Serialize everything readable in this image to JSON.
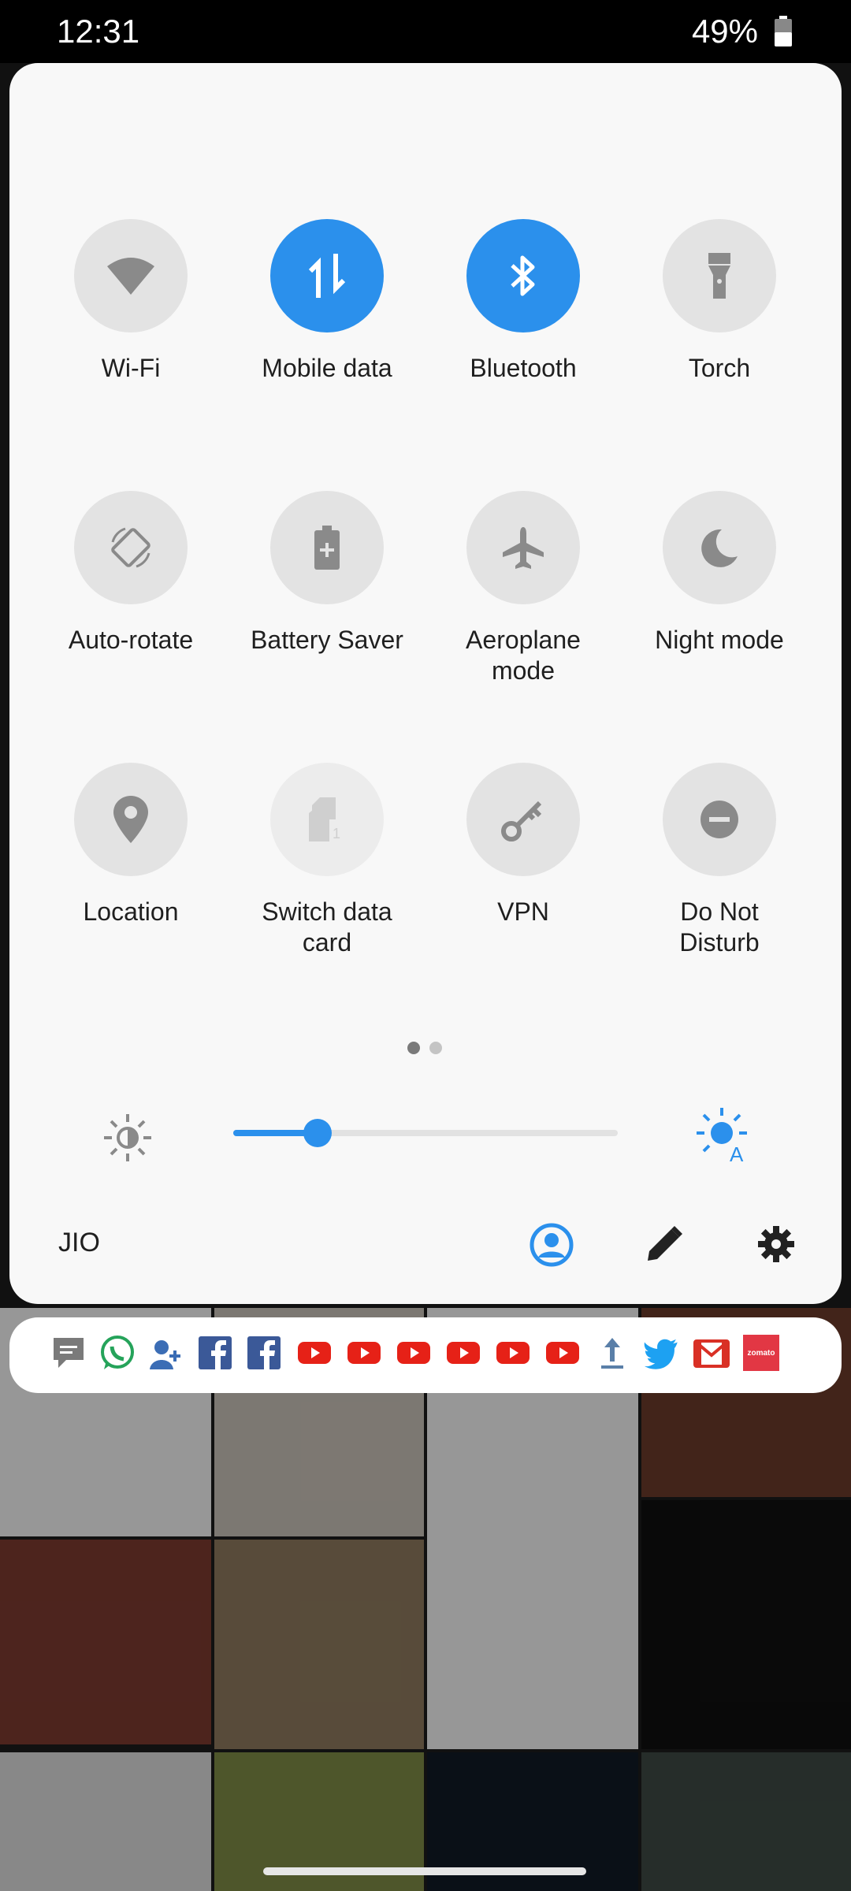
{
  "status_bar": {
    "time": "12:31",
    "battery": "49%"
  },
  "tiles": [
    {
      "label": "Wi-Fi",
      "icon": "wifi-icon",
      "state": "off"
    },
    {
      "label": "Mobile data",
      "icon": "mobile-data-icon",
      "state": "on"
    },
    {
      "label": "Bluetooth",
      "icon": "bluetooth-icon",
      "state": "on"
    },
    {
      "label": "Torch",
      "icon": "torch-icon",
      "state": "off"
    },
    {
      "label": "Auto-rotate",
      "icon": "auto-rotate-icon",
      "state": "off"
    },
    {
      "label": "Battery Saver",
      "icon": "battery-saver-icon",
      "state": "off"
    },
    {
      "label": "Aeroplane mode",
      "icon": "aeroplane-icon",
      "state": "off"
    },
    {
      "label": "Night mode",
      "icon": "night-mode-icon",
      "state": "off"
    },
    {
      "label": "Location",
      "icon": "location-icon",
      "state": "off"
    },
    {
      "label": "Switch data card",
      "icon": "sim-card-icon",
      "state": "disabled"
    },
    {
      "label": "VPN",
      "icon": "vpn-key-icon",
      "state": "off"
    },
    {
      "label": "Do Not Disturb",
      "icon": "do-not-disturb-icon",
      "state": "off"
    }
  ],
  "pager": {
    "pages": 2,
    "current": 1
  },
  "brightness": {
    "level": 0.22,
    "auto_icon": "auto-brightness-icon"
  },
  "footer": {
    "carrier": "JIO"
  },
  "notification_icons": [
    "messages-icon",
    "whatsapp-icon",
    "contacts-icon",
    "facebook-icon",
    "facebook-icon",
    "youtube-icon",
    "youtube-icon",
    "youtube-icon",
    "youtube-icon",
    "youtube-icon",
    "youtube-icon",
    "upload-icon",
    "twitter-icon",
    "gmail-icon",
    "zomato-icon"
  ],
  "zomato_label": "zomato",
  "colors": {
    "accent": "#2b90ec",
    "tile_off": "#e3e3e3",
    "panel": "#f8f8f8",
    "youtube": "#e62117",
    "facebook": "#3b5998",
    "twitter": "#1da1f2",
    "whatsapp": "#25d366"
  }
}
